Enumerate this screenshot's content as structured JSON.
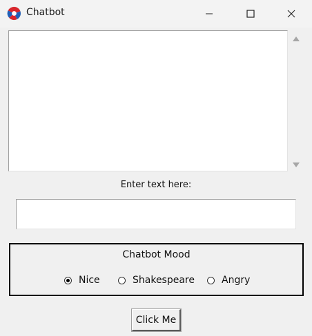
{
  "window": {
    "title": "Chatbot",
    "icon": "red-blue-app-icon",
    "controls": [
      "minimize-icon",
      "maximize-icon",
      "close-icon"
    ]
  },
  "chat": {
    "log_text": ""
  },
  "input": {
    "label": "Enter text here:",
    "value": ""
  },
  "mood": {
    "title": "Chatbot Mood",
    "options": [
      {
        "label": "Nice",
        "selected": true
      },
      {
        "label": "Shakespeare",
        "selected": false
      },
      {
        "label": "Angry",
        "selected": false
      }
    ]
  },
  "actions": {
    "submit_label": "Click Me"
  },
  "colors": {
    "window_bg": "#f0f0f0",
    "titlebar_bg": "#f3f3f3",
    "field_bg": "#ffffff",
    "frame_border": "#000000"
  }
}
